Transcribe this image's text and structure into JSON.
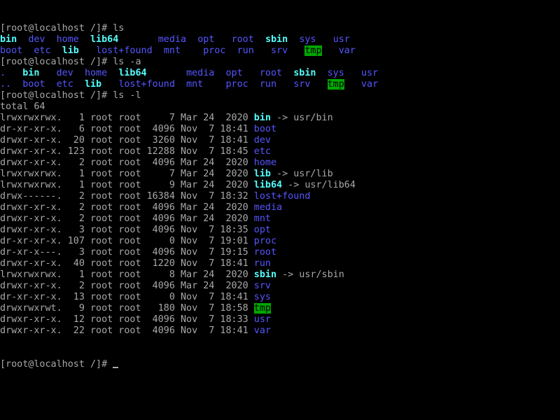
{
  "terminal": {
    "lines": [
      [
        {
          "t": "[root@localhost /]# ls",
          "k": "normal"
        }
      ],
      [
        {
          "t": "bin",
          "k": "link"
        },
        {
          "t": "  ",
          "k": "normal"
        },
        {
          "t": "dev",
          "k": "dir"
        },
        {
          "t": "  ",
          "k": "normal"
        },
        {
          "t": "home",
          "k": "dir"
        },
        {
          "t": "  ",
          "k": "normal"
        },
        {
          "t": "lib64",
          "k": "link"
        },
        {
          "t": "       ",
          "k": "normal"
        },
        {
          "t": "media",
          "k": "dir"
        },
        {
          "t": "  ",
          "k": "normal"
        },
        {
          "t": "opt",
          "k": "dir"
        },
        {
          "t": "   ",
          "k": "normal"
        },
        {
          "t": "root",
          "k": "dir"
        },
        {
          "t": "  ",
          "k": "normal"
        },
        {
          "t": "sbin",
          "k": "link"
        },
        {
          "t": "  ",
          "k": "normal"
        },
        {
          "t": "sys",
          "k": "dir"
        },
        {
          "t": "   ",
          "k": "normal"
        },
        {
          "t": "usr",
          "k": "dir"
        }
      ],
      [
        {
          "t": "boot",
          "k": "dir"
        },
        {
          "t": "  ",
          "k": "normal"
        },
        {
          "t": "etc",
          "k": "dir"
        },
        {
          "t": "  ",
          "k": "normal"
        },
        {
          "t": "lib",
          "k": "link"
        },
        {
          "t": "   ",
          "k": "normal"
        },
        {
          "t": "lost+found",
          "k": "dir"
        },
        {
          "t": "  ",
          "k": "normal"
        },
        {
          "t": "mnt",
          "k": "dir"
        },
        {
          "t": "    ",
          "k": "normal"
        },
        {
          "t": "proc",
          "k": "dir"
        },
        {
          "t": "  ",
          "k": "normal"
        },
        {
          "t": "run",
          "k": "dir"
        },
        {
          "t": "   ",
          "k": "normal"
        },
        {
          "t": "srv",
          "k": "dir"
        },
        {
          "t": "   ",
          "k": "normal"
        },
        {
          "t": "tmp",
          "k": "sticky"
        },
        {
          "t": "   ",
          "k": "normal"
        },
        {
          "t": "var",
          "k": "dir"
        }
      ],
      [
        {
          "t": "[root@localhost /]# ls -a",
          "k": "normal"
        }
      ],
      [
        {
          "t": ".",
          "k": "dir"
        },
        {
          "t": "   ",
          "k": "normal"
        },
        {
          "t": "bin",
          "k": "link"
        },
        {
          "t": "   ",
          "k": "normal"
        },
        {
          "t": "dev",
          "k": "dir"
        },
        {
          "t": "  ",
          "k": "normal"
        },
        {
          "t": "home",
          "k": "dir"
        },
        {
          "t": "  ",
          "k": "normal"
        },
        {
          "t": "lib64",
          "k": "link"
        },
        {
          "t": "       ",
          "k": "normal"
        },
        {
          "t": "media",
          "k": "dir"
        },
        {
          "t": "  ",
          "k": "normal"
        },
        {
          "t": "opt",
          "k": "dir"
        },
        {
          "t": "   ",
          "k": "normal"
        },
        {
          "t": "root",
          "k": "dir"
        },
        {
          "t": "  ",
          "k": "normal"
        },
        {
          "t": "sbin",
          "k": "link"
        },
        {
          "t": "  ",
          "k": "normal"
        },
        {
          "t": "sys",
          "k": "dir"
        },
        {
          "t": "   ",
          "k": "normal"
        },
        {
          "t": "usr",
          "k": "dir"
        }
      ],
      [
        {
          "t": "..",
          "k": "dir"
        },
        {
          "t": "  ",
          "k": "normal"
        },
        {
          "t": "boot",
          "k": "dir"
        },
        {
          "t": "  ",
          "k": "normal"
        },
        {
          "t": "etc",
          "k": "dir"
        },
        {
          "t": "  ",
          "k": "normal"
        },
        {
          "t": "lib",
          "k": "link"
        },
        {
          "t": "   ",
          "k": "normal"
        },
        {
          "t": "lost+found",
          "k": "dir"
        },
        {
          "t": "  ",
          "k": "normal"
        },
        {
          "t": "mnt",
          "k": "dir"
        },
        {
          "t": "    ",
          "k": "normal"
        },
        {
          "t": "proc",
          "k": "dir"
        },
        {
          "t": "  ",
          "k": "normal"
        },
        {
          "t": "run",
          "k": "dir"
        },
        {
          "t": "   ",
          "k": "normal"
        },
        {
          "t": "srv",
          "k": "dir"
        },
        {
          "t": "   ",
          "k": "normal"
        },
        {
          "t": "tmp",
          "k": "sticky"
        },
        {
          "t": "   ",
          "k": "normal"
        },
        {
          "t": "var",
          "k": "dir"
        }
      ],
      [
        {
          "t": "[root@localhost /]# ls -l",
          "k": "normal"
        }
      ],
      [
        {
          "t": "total 64",
          "k": "normal"
        }
      ],
      [
        {
          "t": "lrwxrwxrwx.   1 root root     7 Mar 24  2020 ",
          "k": "normal"
        },
        {
          "t": "bin",
          "k": "link"
        },
        {
          "t": " -> usr/bin",
          "k": "normal"
        }
      ],
      [
        {
          "t": "dr-xr-xr-x.   6 root root  4096 Nov  7 18:41 ",
          "k": "normal"
        },
        {
          "t": "boot",
          "k": "dir"
        }
      ],
      [
        {
          "t": "drwxr-xr-x.  20 root root  3260 Nov  7 18:41 ",
          "k": "normal"
        },
        {
          "t": "dev",
          "k": "dir"
        }
      ],
      [
        {
          "t": "drwxr-xr-x. 123 root root 12288 Nov  7 18:45 ",
          "k": "normal"
        },
        {
          "t": "etc",
          "k": "dir"
        }
      ],
      [
        {
          "t": "drwxr-xr-x.   2 root root  4096 Mar 24  2020 ",
          "k": "normal"
        },
        {
          "t": "home",
          "k": "dir"
        }
      ],
      [
        {
          "t": "lrwxrwxrwx.   1 root root     7 Mar 24  2020 ",
          "k": "normal"
        },
        {
          "t": "lib",
          "k": "link"
        },
        {
          "t": " -> usr/lib",
          "k": "normal"
        }
      ],
      [
        {
          "t": "lrwxrwxrwx.   1 root root     9 Mar 24  2020 ",
          "k": "normal"
        },
        {
          "t": "lib64",
          "k": "link"
        },
        {
          "t": " -> usr/lib64",
          "k": "normal"
        }
      ],
      [
        {
          "t": "drwx------.   2 root root 16384 Nov  7 18:32 ",
          "k": "normal"
        },
        {
          "t": "lost+found",
          "k": "dir"
        }
      ],
      [
        {
          "t": "drwxr-xr-x.   2 root root  4096 Mar 24  2020 ",
          "k": "normal"
        },
        {
          "t": "media",
          "k": "dir"
        }
      ],
      [
        {
          "t": "drwxr-xr-x.   2 root root  4096 Mar 24  2020 ",
          "k": "normal"
        },
        {
          "t": "mnt",
          "k": "dir"
        }
      ],
      [
        {
          "t": "drwxr-xr-x.   3 root root  4096 Nov  7 18:35 ",
          "k": "normal"
        },
        {
          "t": "opt",
          "k": "dir"
        }
      ],
      [
        {
          "t": "dr-xr-xr-x. 107 root root     0 Nov  7 19:01 ",
          "k": "normal"
        },
        {
          "t": "proc",
          "k": "dir"
        }
      ],
      [
        {
          "t": "dr-xr-x---.   3 root root  4096 Nov  7 19:15 ",
          "k": "normal"
        },
        {
          "t": "root",
          "k": "dir"
        }
      ],
      [
        {
          "t": "drwxr-xr-x.  40 root root  1220 Nov  7 18:41 ",
          "k": "normal"
        },
        {
          "t": "run",
          "k": "dir"
        }
      ],
      [
        {
          "t": "lrwxrwxrwx.   1 root root     8 Mar 24  2020 ",
          "k": "normal"
        },
        {
          "t": "sbin",
          "k": "link"
        },
        {
          "t": " -> usr/sbin",
          "k": "normal"
        }
      ],
      [
        {
          "t": "drwxr-xr-x.   2 root root  4096 Mar 24  2020 ",
          "k": "normal"
        },
        {
          "t": "srv",
          "k": "dir"
        }
      ],
      [
        {
          "t": "dr-xr-xr-x.  13 root root     0 Nov  7 18:41 ",
          "k": "normal"
        },
        {
          "t": "sys",
          "k": "dir"
        }
      ],
      [
        {
          "t": "drwxrwxrwt.   9 root root   180 Nov  7 18:58 ",
          "k": "normal"
        },
        {
          "t": "tmp",
          "k": "sticky"
        }
      ],
      [
        {
          "t": "drwxr-xr-x.  12 root root  4096 Nov  7 18:33 ",
          "k": "normal"
        },
        {
          "t": "usr",
          "k": "dir"
        }
      ],
      [
        {
          "t": "drwxr-xr-x.  22 root root  4096 Nov  7 18:41 ",
          "k": "normal"
        },
        {
          "t": "var",
          "k": "dir"
        }
      ]
    ],
    "prompt": "[root@localhost /]# "
  },
  "colors": {
    "background": "#000000",
    "text": "#a8a8a8",
    "directory": "#5656ff",
    "symlink": "#54fefe",
    "sticky_bg": "#00a800"
  }
}
